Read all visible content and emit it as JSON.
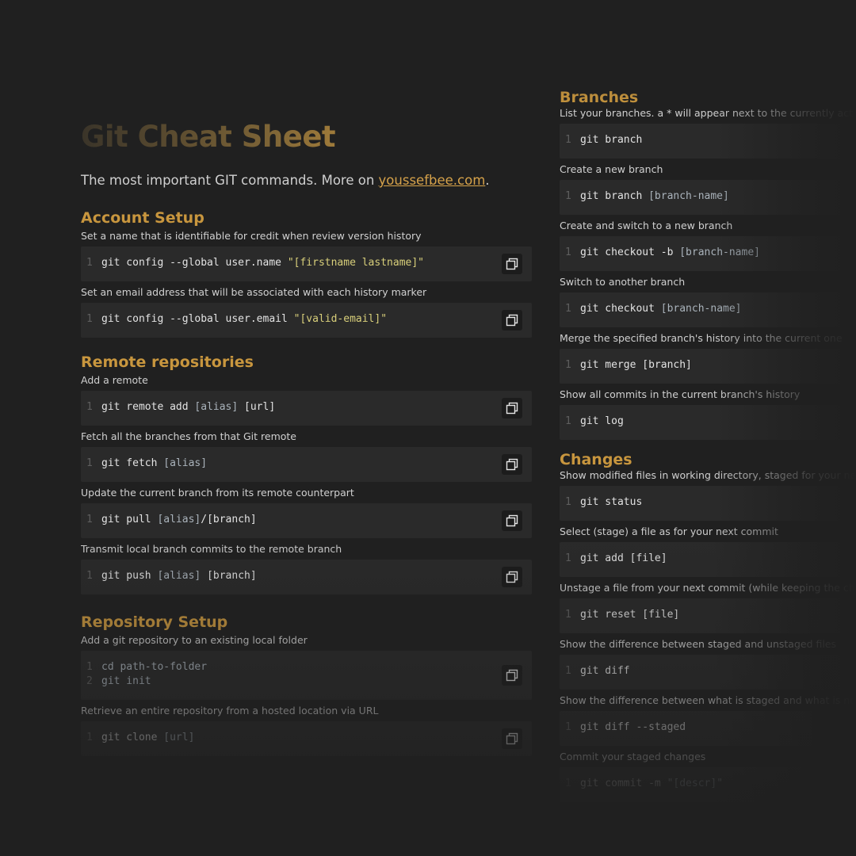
{
  "header": {
    "title": "Git Cheat Sheet",
    "subtitle_text": "The most important GIT commands. More on ",
    "subtitle_link": "youssefbee.com",
    "subtitle_end": "."
  },
  "left": {
    "account": {
      "title": "Account Setup",
      "items": [
        {
          "desc": "Set a name that is identifiable for credit when review version history",
          "ln": "1",
          "cmd": "git config --global user.name ",
          "str": "\"[firstname lastname]\""
        },
        {
          "desc": "Set an email address that will be associated with each history marker",
          "ln": "1",
          "cmd": "git config --global user.email ",
          "str": "\"[valid-email]\""
        }
      ]
    },
    "remote": {
      "title": "Remote repositories",
      "items": [
        {
          "desc": "Add a remote",
          "ln": "1",
          "cmd": "git remote add ",
          "arg": "[alias]",
          "rest": " [url]"
        },
        {
          "desc": "Fetch all the branches from that Git remote",
          "ln": "1",
          "cmd": "git fetch ",
          "arg": "[alias]"
        },
        {
          "desc": "Update the current branch from its remote counterpart",
          "ln": "1",
          "cmd": "git pull ",
          "arg": "[alias]",
          "rest": "/[branch]"
        },
        {
          "desc": "Transmit local branch commits to the remote branch",
          "ln": "1",
          "cmd": "git push ",
          "arg": "[alias]",
          "rest": " [branch]"
        }
      ]
    },
    "repo": {
      "title": "Repository Setup",
      "items": [
        {
          "desc": "Add a git repository to an existing local folder",
          "lines": [
            {
              "ln": "1",
              "cmd": "cd path-to-folder"
            },
            {
              "ln": "2",
              "cmd": "git init"
            }
          ]
        },
        {
          "desc": "Retrieve an entire repository from a hosted location via URL",
          "ln": "1",
          "cmd": "git clone ",
          "arg": "[url]"
        }
      ]
    }
  },
  "right": {
    "branches": {
      "title": "Branches",
      "items": [
        {
          "desc": "List your branches. a * will appear next to the currently active b",
          "ln": "1",
          "cmd": "git branch"
        },
        {
          "desc": "Create a new branch",
          "ln": "1",
          "cmd": "git branch ",
          "arg": "[branch-name]"
        },
        {
          "desc": "Create and switch to a new branch",
          "ln": "1",
          "cmd": "git checkout -b ",
          "arg": "[branch-name]"
        },
        {
          "desc": "Switch to another branch",
          "ln": "1",
          "cmd": "git checkout ",
          "arg": "[branch-name]"
        },
        {
          "desc": "Merge the specified branch's history into the current one",
          "ln": "1",
          "cmd": "git merge [branch]"
        },
        {
          "desc": "Show all commits in the current branch's history",
          "ln": "1",
          "cmd": "git log"
        }
      ]
    },
    "changes": {
      "title": "Changes",
      "items": [
        {
          "desc": "Show modified files in working directory, staged for your next c",
          "ln": "1",
          "cmd": "git status"
        },
        {
          "desc": "Select (stage) a file as for your next commit",
          "ln": "1",
          "cmd": "git add [file]"
        },
        {
          "desc": "Unstage a file from your next commit (while keeping the change",
          "ln": "1",
          "cmd": "git reset [file]"
        },
        {
          "desc": "Show the difference between staged and unstaged files",
          "ln": "1",
          "cmd": "git diff"
        },
        {
          "desc": "Show the difference between what is staged and what is not",
          "ln": "1",
          "cmd": "git diff --staged"
        },
        {
          "desc": "Commit your staged changes",
          "ln": "1",
          "cmd": "git commit -m ",
          "str": "\"[descr]\""
        }
      ]
    }
  },
  "icons": {
    "copy": "copy-icon"
  },
  "colors": {
    "accent": "#c8963e",
    "link": "#d6a24a",
    "code_bg": "#2a2a2a",
    "string": "#d8cf7a"
  }
}
